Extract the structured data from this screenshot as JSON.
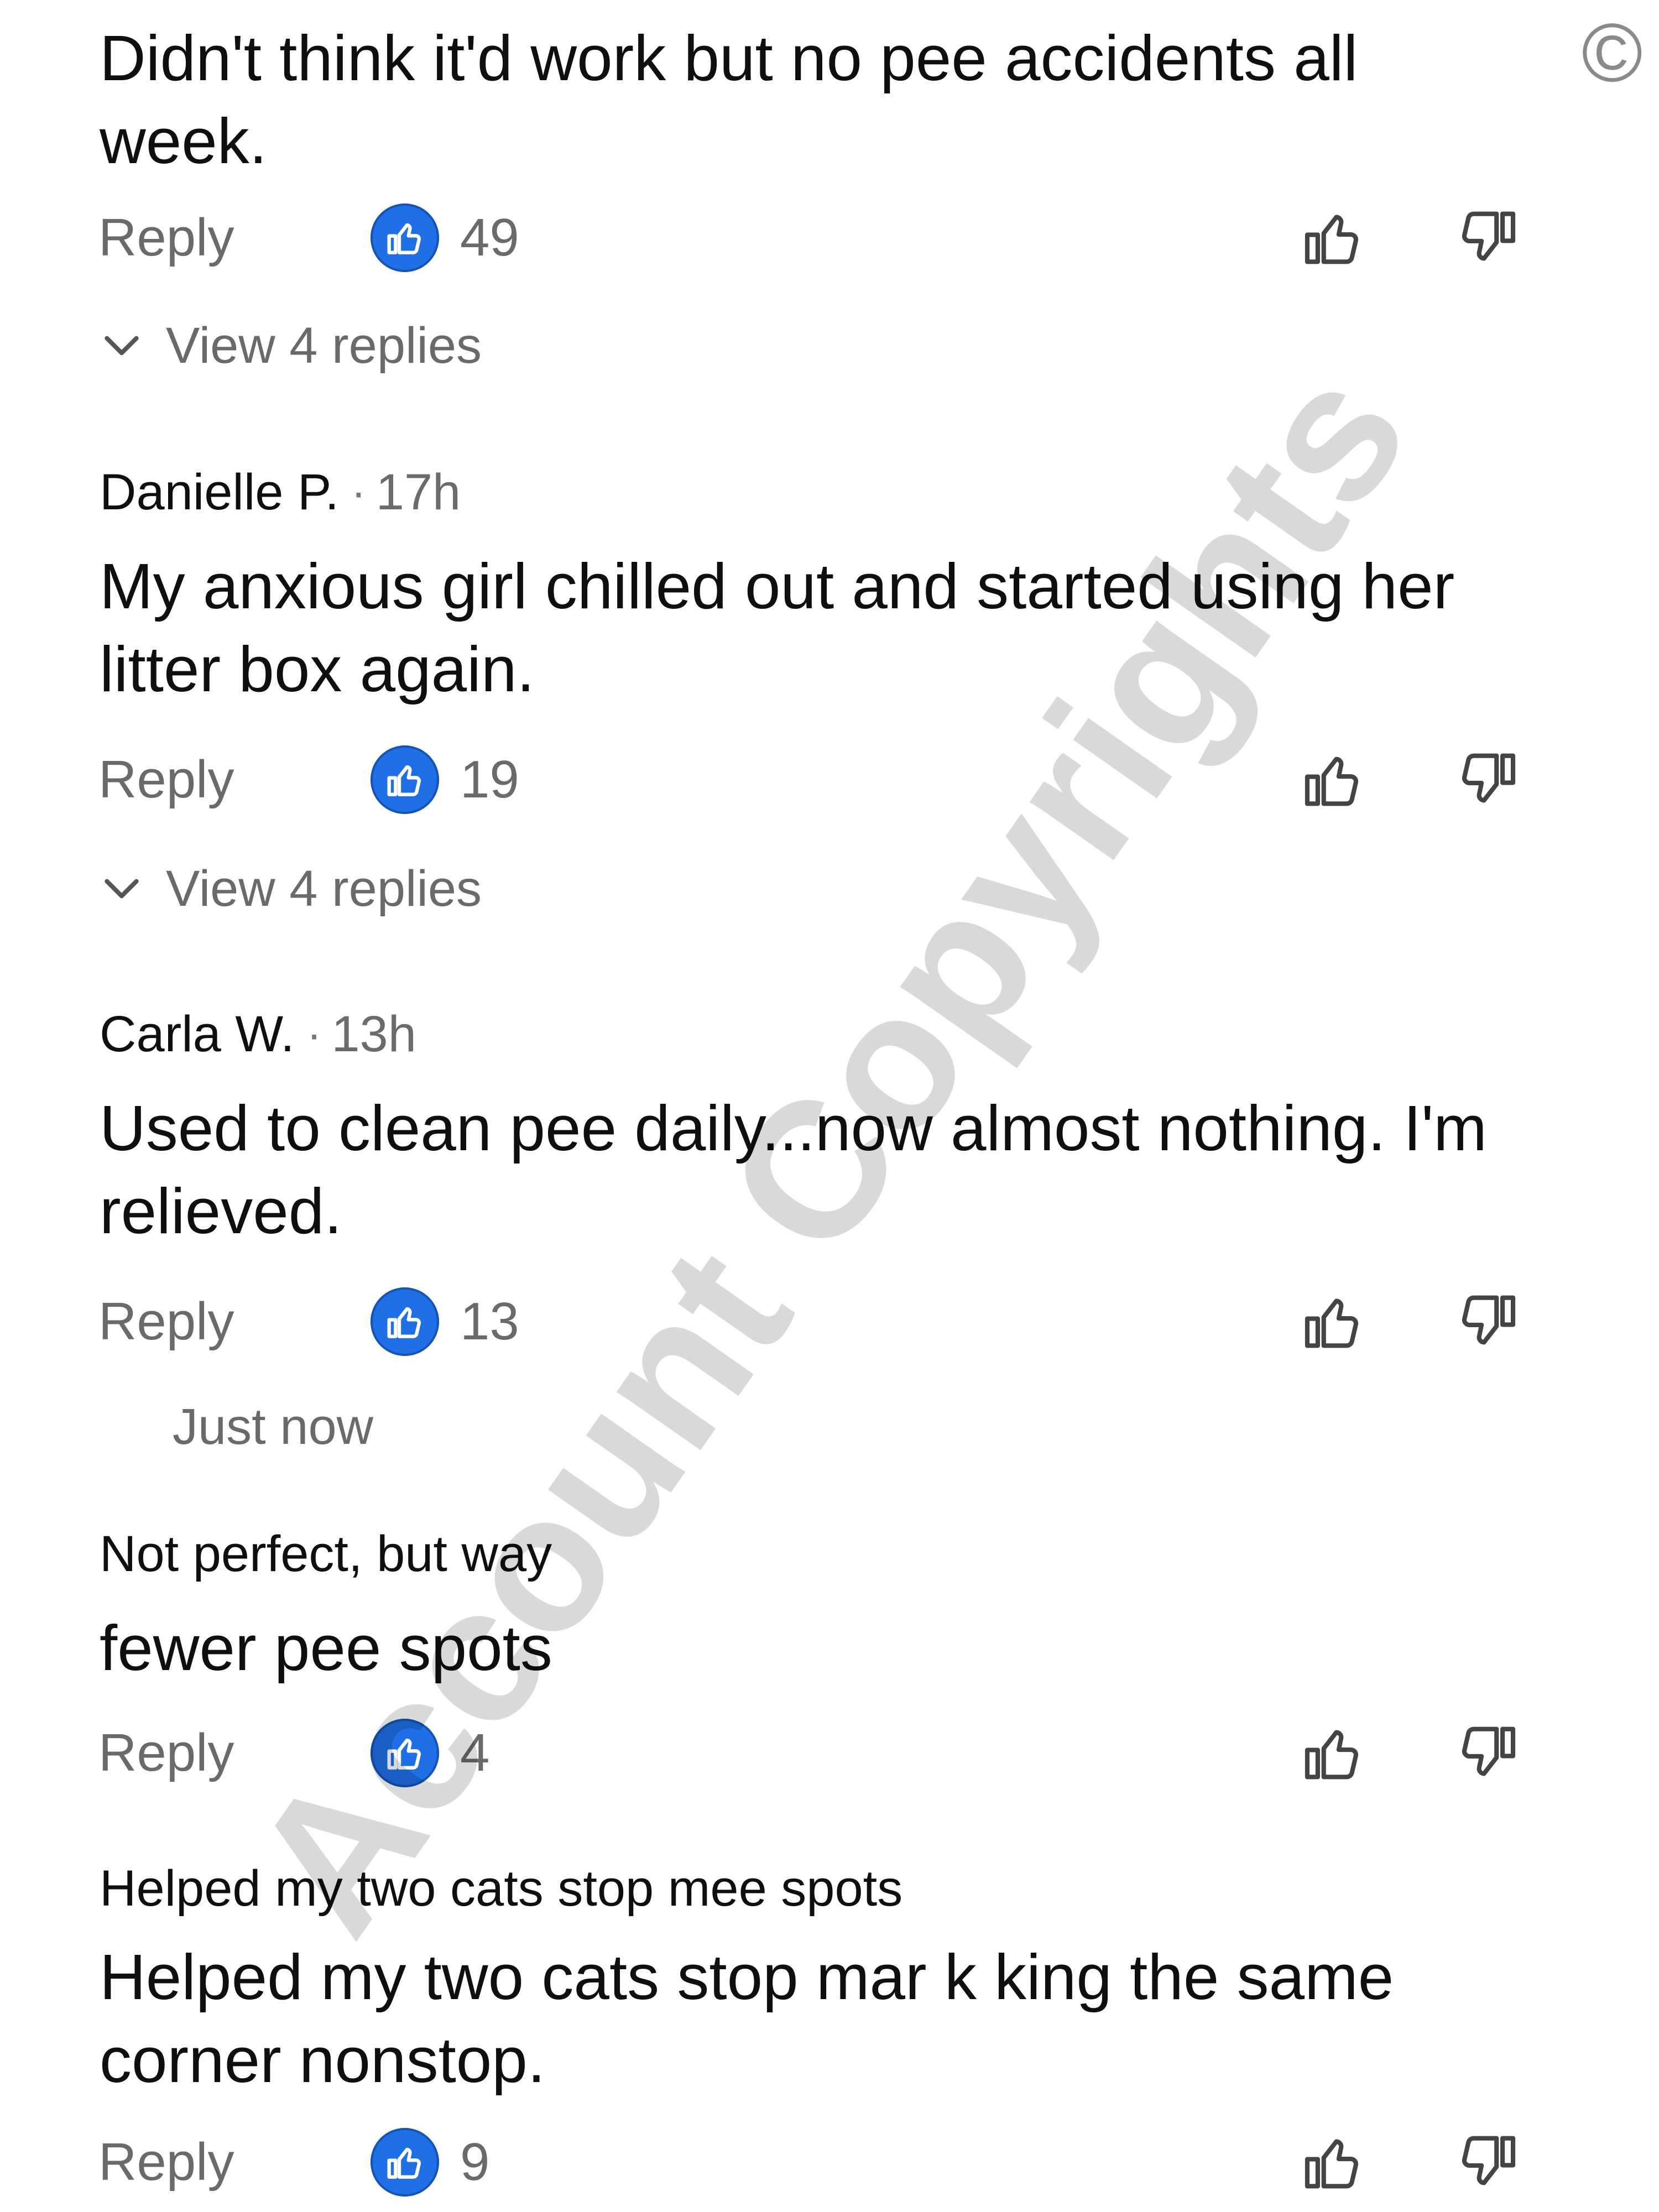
{
  "copyright_symbol": "©",
  "watermark": "Account Copyrights",
  "actions": {
    "reply_label": "Reply"
  },
  "colors": {
    "like_badge": "#1f6fe6",
    "text": "#0f0f0f",
    "muted": "#6a6a6a"
  },
  "icons": {
    "like_badge": "thumbs-up-icon",
    "like": "thumbs-up-outline-icon",
    "dislike": "thumbs-down-outline-icon",
    "expand": "chevron-down-icon"
  },
  "comments": [
    {
      "author": "",
      "time": "",
      "text": "Didn't think it'd work but no pee accidents all week.",
      "likes": "49",
      "replies_label": "View 4 replies"
    },
    {
      "author": "Danielle P.",
      "time": "17h",
      "text": "My anxious girl chilled out and started using her litter box again.",
      "likes": "19",
      "replies_label": "View 4 replies"
    },
    {
      "author": "Carla W.",
      "time": "13h",
      "text": "Used to clean  pee daily...now almost nothing. I'm relieved.",
      "likes": "13",
      "status": "Just now"
    },
    {
      "header": "Not perfect,  but way",
      "text": "fewer pee spots",
      "likes": "4"
    },
    {
      "header": "Helped my two cats stop  mee spots",
      "text": "Helped my two cats stop mar k king the same corner nonstop.",
      "likes": "9"
    }
  ]
}
